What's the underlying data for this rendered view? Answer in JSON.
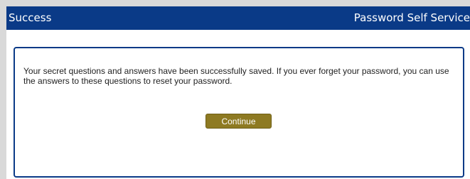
{
  "header": {
    "title": "Success",
    "app_name": "Password Self Service"
  },
  "main": {
    "message": "Your secret questions and answers have been successfully saved. If you ever forget your password, you can use the answers to these questions to reset your password.",
    "continue_label": "Continue"
  },
  "colors": {
    "header_bg": "#0a3a87",
    "button_bg": "#8e7a22",
    "page_bg": "#d9d9d9"
  }
}
